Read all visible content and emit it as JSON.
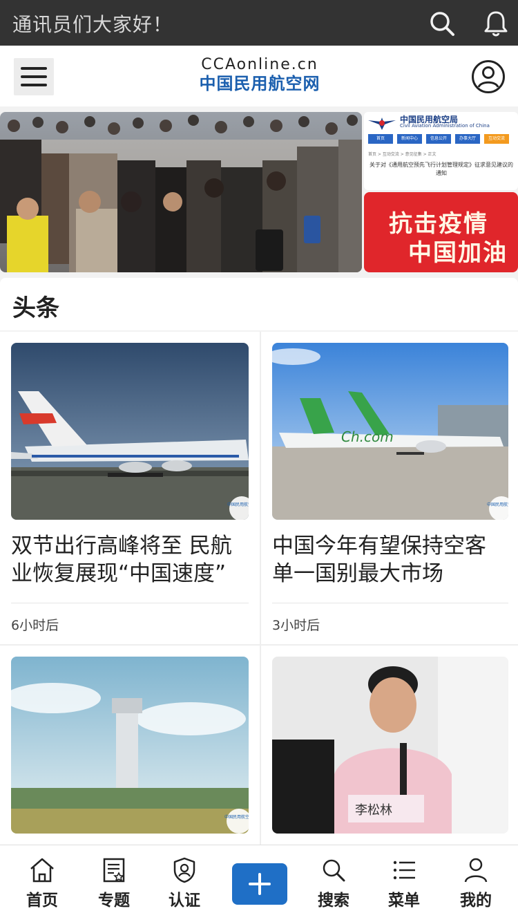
{
  "topbar": {
    "greeting": "通讯员们大家好！",
    "search_icon": "search-icon",
    "bell_icon": "bell-icon"
  },
  "header": {
    "logo_line1": "CCAonline.cn",
    "logo_line2": "中国民用航空网",
    "menu_icon": "hamburger-icon",
    "user_icon": "user-circle-icon"
  },
  "banner": {
    "side1": {
      "org_cn": "中国民用航空局",
      "org_en": "Civil Aviation Administration of China",
      "nav": [
        "首页",
        "新闻中心",
        "信息公开",
        "办事大厅",
        "互动交流"
      ],
      "crumb": "首页 > 互动交流 > 意见征集 > 正文",
      "notice": "关于对《通用航空预先飞行计划管理规定》征求意见建议的通知"
    },
    "side2": {
      "line1": "抗击疫情",
      "line2": "中国加油"
    }
  },
  "section": {
    "title": "头条"
  },
  "articles": [
    {
      "title": "双节出行高峰将至 民航业恢复展现“中国速度”",
      "time": "6小时后",
      "watermark": "中国民用航空网"
    },
    {
      "title": "中国今年有望保持空客单一国别最大市场",
      "time": "3小时后",
      "watermark": "中国民用航空网"
    },
    {
      "title": "",
      "time": "",
      "watermark": "中国民用航空网"
    },
    {
      "title": "",
      "time": "",
      "name_plate": "李松林"
    }
  ],
  "bottom_nav": {
    "items": [
      {
        "label": "首页",
        "icon": "home-icon"
      },
      {
        "label": "专题",
        "icon": "topic-icon"
      },
      {
        "label": "认证",
        "icon": "shield-user-icon"
      },
      {
        "label": "搜索",
        "icon": "search-icon"
      },
      {
        "label": "菜单",
        "icon": "list-icon"
      },
      {
        "label": "我的",
        "icon": "person-icon"
      }
    ],
    "plus_icon": "plus-icon"
  },
  "colors": {
    "topbar_bg": "#333333",
    "brand_blue": "#1b5fae",
    "plus_blue": "#1f6fc6",
    "banner_red": "#e0262b"
  }
}
